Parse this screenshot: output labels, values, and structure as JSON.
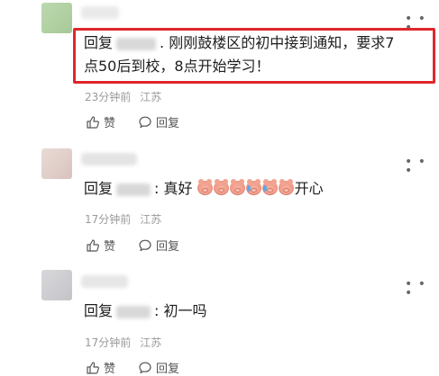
{
  "ui": {
    "more_glyph": "• • •",
    "reply_prefix": "回复",
    "like_label": "赞",
    "reply_label": "回复"
  },
  "comments": [
    {
      "text_line1": ". 刚刚鼓楼区的初中接到通知，要求7",
      "text_line2": "点50后到校，8点开始学习！",
      "time": "23分钟前",
      "location": "江苏",
      "highlighted": true,
      "highlight_color": "#e0262a"
    },
    {
      "text": ": 真好",
      "emoji_names": [
        "pig-face-emoji",
        "pig-face-emoji",
        "pig-face-emoji",
        "crying-pig-emoji",
        "crying-pig-emoji",
        "pig-face-emoji"
      ],
      "suffix": "开心",
      "time": "17分钟前",
      "location": "江苏"
    },
    {
      "text": ": 初一吗",
      "time": "17分钟前",
      "location": "江苏"
    }
  ]
}
